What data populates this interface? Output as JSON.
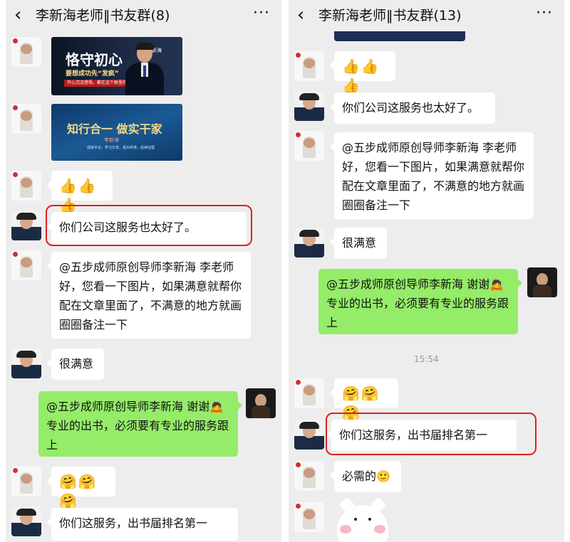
{
  "left": {
    "title": "李新海老师‖书友群(8)",
    "back_icon": "‹",
    "more_icon": "···",
    "image1": {
      "headline": "恪守初心",
      "subline": "要想成功先“发疯”",
      "strip": "开心沉淀感悟，都在这个群里的成长的逐梦",
      "name": "李新海"
    },
    "image2": {
      "headline": "知行合一  做实干家",
      "name": "李新海",
      "small": "成就平台，学习分享，强大终将，后续征程"
    },
    "msg_thumbs": "👍👍👍",
    "msg_praise": "你们公司这服务也太好了。",
    "msg_long": "@五步成师原创导师李新海  李老师好，您看一下图片，如果满意就帮你配在文章里面了，不满意的地方就画圈圈备注一下",
    "msg_satisfied": "很满意",
    "msg_green": "@五步成师原创导师李新海  谢谢🙇 专业的出书，必须要有专业的服务跟上",
    "msg_hug": "🤗🤗🤗",
    "msg_rank": "你们这服务，出书届排名第一"
  },
  "right": {
    "title": "李新海老师‖书友群(13)",
    "back_icon": "‹",
    "more_icon": "···",
    "msg_thumbs": "👍👍👍",
    "msg_praise": "你们公司这服务也太好了。",
    "msg_long": "@五步成师原创导师李新海  李老师好，您看一下图片，如果满意就帮你配在文章里面了，不满意的地方就画圈圈备注一下",
    "msg_satisfied": "很满意",
    "msg_green": "@五步成师原创导师李新海  谢谢🙇 专业的出书，必须要有专业的服务跟上",
    "time": "15:54",
    "msg_hug": "🤗🤗🤗",
    "msg_rank": "你们这服务，出书届排名第一",
    "msg_needed": "必需的🙂"
  },
  "colors": {
    "chat_bg": "#ededed",
    "bubble_white": "#ffffff",
    "bubble_green": "#95ec69",
    "highlight": "#e02020"
  }
}
